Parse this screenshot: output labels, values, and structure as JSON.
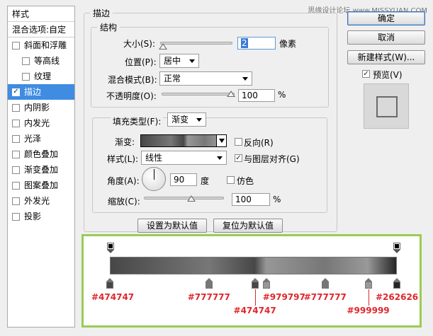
{
  "watermark": "思缘设计论坛  www.MISSYUAN.COM",
  "stylelist": {
    "header": "样式",
    "blend_options": "混合选项:自定",
    "items": [
      {
        "label": "斜面和浮雕",
        "checked": false
      },
      {
        "label": "等高线",
        "checked": false
      },
      {
        "label": "纹理",
        "checked": false
      },
      {
        "label": "描边",
        "checked": true
      },
      {
        "label": "内阴影",
        "checked": false
      },
      {
        "label": "内发光",
        "checked": false
      },
      {
        "label": "光泽",
        "checked": false
      },
      {
        "label": "颜色叠加",
        "checked": false
      },
      {
        "label": "渐变叠加",
        "checked": false
      },
      {
        "label": "图案叠加",
        "checked": false
      },
      {
        "label": "外发光",
        "checked": false
      },
      {
        "label": "投影",
        "checked": false
      }
    ]
  },
  "stroke": {
    "title": "描边",
    "structure": {
      "title": "结构",
      "size_label": "大小(S):",
      "size_value": "2",
      "size_unit": "像素",
      "position_label": "位置(P):",
      "position_value": "居中",
      "blend_label": "混合模式(B):",
      "blend_value": "正常",
      "opacity_label": "不透明度(O):",
      "opacity_value": "100",
      "opacity_unit": "%"
    },
    "fill": {
      "type_label": "填充类型(F):",
      "type_value": "渐变",
      "gradient_label": "渐变:",
      "reverse_label": "反向(R)",
      "reverse_checked": false,
      "style_label": "样式(L):",
      "style_value": "线性",
      "align_label": "与图层对齐(G)",
      "align_checked": true,
      "angle_label": "角度(A):",
      "angle_value": "90",
      "angle_unit": "度",
      "dither_label": "仿色",
      "dither_checked": false,
      "scale_label": "缩放(C):",
      "scale_value": "100",
      "scale_unit": "%"
    },
    "make_default": "设置为默认值",
    "reset_default": "复位为默认值"
  },
  "buttons": {
    "ok": "确定",
    "cancel": "取消",
    "new_style": "新建样式(W)...",
    "preview_label": "预览(V)",
    "preview_checked": true
  },
  "gradient_editor": {
    "stops": [
      {
        "label": "#474747",
        "color": "#474747",
        "pos": 0
      },
      {
        "label": "#777777",
        "color": "#777777",
        "pos": 0.345
      },
      {
        "label": "#474747",
        "color": "#474747",
        "pos": 0.505
      },
      {
        "label": "#979797",
        "color": "#979797",
        "pos": 0.545
      },
      {
        "label": "#777777",
        "color": "#777777",
        "pos": 0.75
      },
      {
        "label": "#999999",
        "color": "#999999",
        "pos": 0.9
      },
      {
        "label": "#262626",
        "color": "#262626",
        "pos": 1
      }
    ]
  },
  "colors": {
    "selection": "#3f8ce2",
    "callout_border": "#99cc55",
    "annotation": "#e0262c"
  }
}
